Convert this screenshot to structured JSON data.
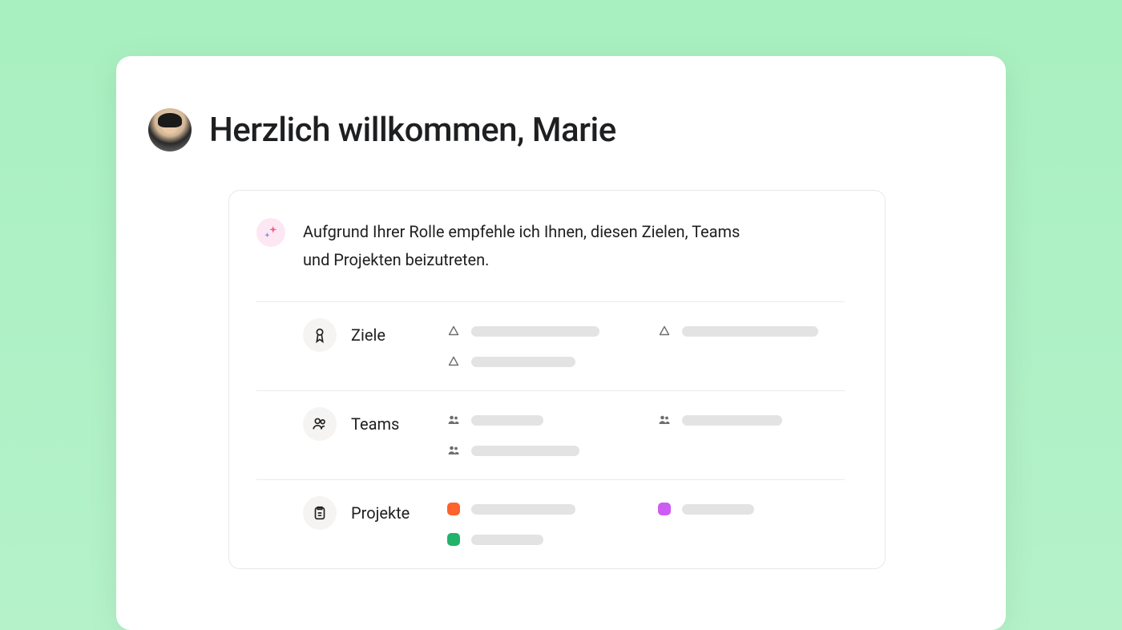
{
  "header": {
    "welcome_title": "Herzlich willkommen, Marie"
  },
  "recommendation": {
    "intro_text": "Aufgrund Ihrer Rolle empfehle ich Ihnen, diesen Zielen, Teams und Projekten beizutreten.",
    "sections": {
      "goals": {
        "label": "Ziele"
      },
      "teams": {
        "label": "Teams"
      },
      "projects": {
        "label": "Projekte"
      }
    },
    "project_colors": {
      "a": "#fd612c",
      "b": "#cd5cf2",
      "c": "#22b36b"
    }
  }
}
